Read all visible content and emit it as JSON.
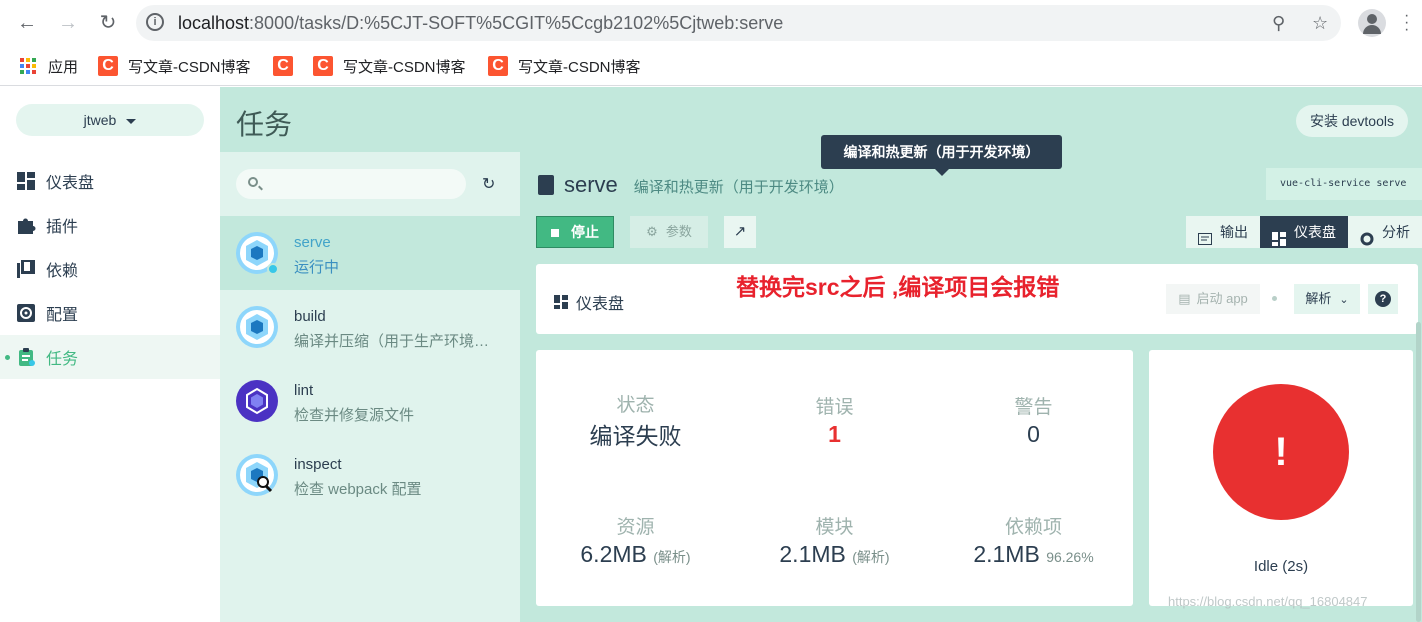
{
  "browser": {
    "url_host": "localhost",
    "url_path": ":8000/tasks/D:%5CJT-SOFT%5CGIT%5Ccgb2102%5Cjtweb:serve",
    "bookmarks": [
      {
        "label": "应用"
      },
      {
        "label": "写文章-CSDN博客"
      },
      {
        "label": ""
      },
      {
        "label": "写文章-CSDN博客"
      },
      {
        "label": "写文章-CSDN博客"
      }
    ]
  },
  "sidebar": {
    "project": "jtweb",
    "items": [
      {
        "label": "仪表盘"
      },
      {
        "label": "插件"
      },
      {
        "label": "依赖"
      },
      {
        "label": "配置"
      },
      {
        "label": "任务"
      }
    ]
  },
  "header": {
    "title": "任务",
    "devtools": "安装 devtools"
  },
  "tasks": [
    {
      "name": "serve",
      "desc": "运行中"
    },
    {
      "name": "build",
      "desc": "编译并压缩（用于生产环境…"
    },
    {
      "name": "lint",
      "desc": "检查并修复源文件"
    },
    {
      "name": "inspect",
      "desc": "检查 webpack 配置"
    }
  ],
  "detail": {
    "tooltip": "编译和热更新（用于开发环境）",
    "task_name": "serve",
    "task_desc": "编译和热更新（用于开发环境）",
    "command": "vue-cli-service serve",
    "stop": "停止",
    "params": "参数",
    "tabs": {
      "output": "输出",
      "dashboard": "仪表盘",
      "analyze": "分析"
    },
    "dashboard_title": "仪表盘",
    "annotation": "替换完src之后 ,编译项目会报错",
    "start_app": "启动 app",
    "analyze_select": "解析",
    "help": "?"
  },
  "stats": {
    "status": {
      "label": "状态",
      "value": "编译失败"
    },
    "errors": {
      "label": "错误",
      "value": "1"
    },
    "warnings": {
      "label": "警告",
      "value": "0"
    },
    "assets": {
      "label": "资源",
      "value": "6.2MB",
      "note": "(解析)"
    },
    "modules": {
      "label": "模块",
      "value": "2.1MB",
      "note": "(解析)"
    },
    "deps": {
      "label": "依赖项",
      "value": "2.1MB",
      "note": "96.26%"
    }
  },
  "status_card": {
    "symbol": "!",
    "text": "Idle (2s)"
  },
  "watermark": "https://blog.csdn.net/qq_16804847",
  "colors": {
    "accent": "#42b983",
    "dark": "#2c3e50",
    "error": "#e83030"
  }
}
